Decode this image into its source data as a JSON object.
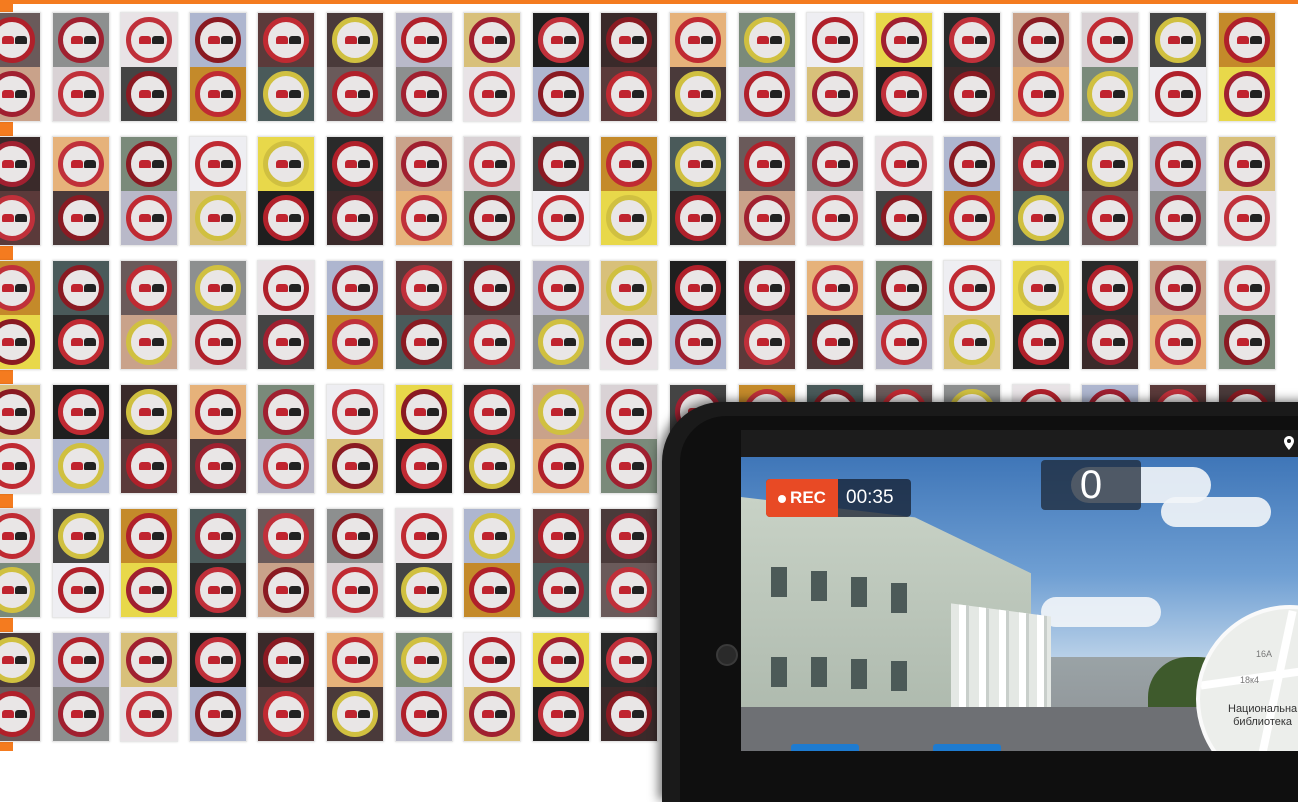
{
  "overlay": {
    "rec_label": "REC",
    "rec_time": "00:35",
    "speed": "0"
  },
  "map": {
    "label_16a": "16А",
    "label_18k4": "18к4",
    "place_line1": "Национальна",
    "place_line2": "библиотека"
  },
  "colors": {
    "accent_orange": "#f47b1f",
    "rec_red": "#e84a25",
    "sign_red": "#b0202a"
  },
  "icons": [
    "location-pin-icon",
    "camera-icon",
    "rec-dot-icon",
    "no-overtaking-sign-icon"
  ]
}
